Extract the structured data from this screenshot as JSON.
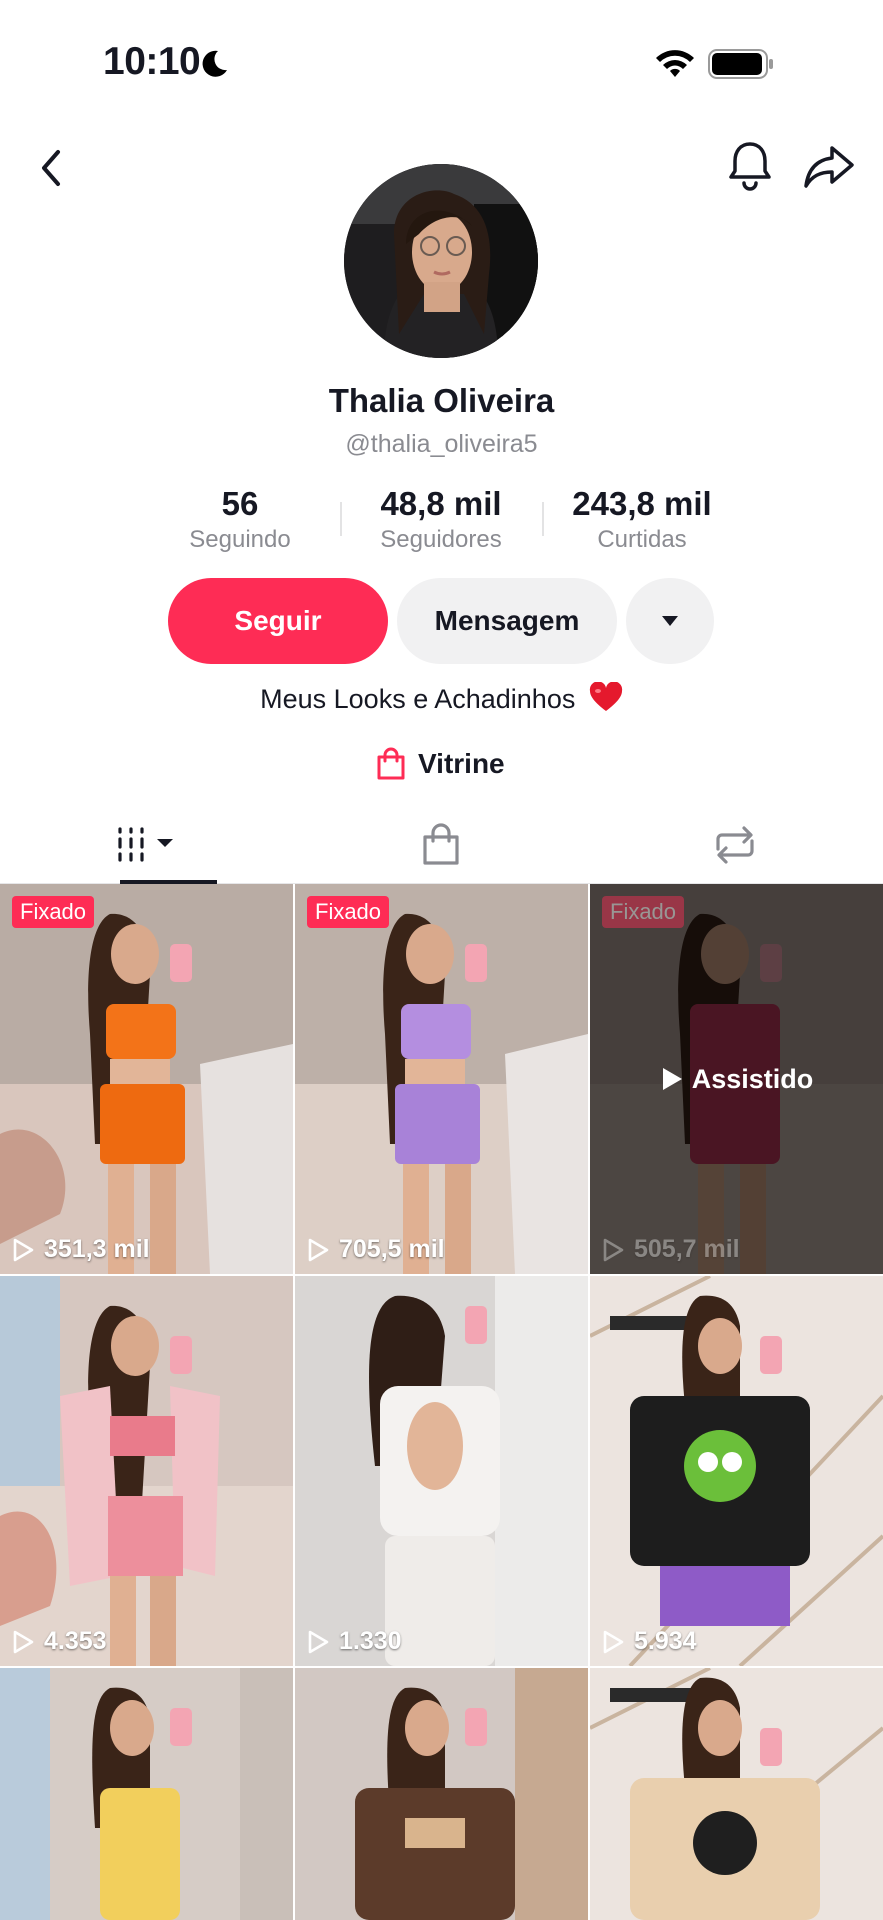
{
  "status_bar": {
    "time": "10:10",
    "icons": [
      "moon-icon",
      "wifi-icon",
      "battery-icon"
    ]
  },
  "nav": {
    "icons": [
      "back-icon",
      "bell-icon",
      "share-icon"
    ]
  },
  "profile": {
    "name": "Thalia Oliveira",
    "handle": "@thalia_oliveira5",
    "stats": [
      {
        "value": "56",
        "label": "Seguindo"
      },
      {
        "value": "48,8 mil",
        "label": "Seguidores"
      },
      {
        "value": "243,8 mil",
        "label": "Curtidas"
      }
    ],
    "bio": "Meus Looks e Achadinhos",
    "bio_emoji": "heart-emoji"
  },
  "actions": {
    "follow_label": "Seguir",
    "message_label": "Mensagem",
    "more_icon": "caret-down-icon"
  },
  "showcase": {
    "label": "Vitrine",
    "icon": "shopping-bag-icon"
  },
  "tabs": [
    {
      "name": "videos",
      "icon": "grid-icon",
      "active": true
    },
    {
      "name": "shop",
      "icon": "shopping-bag-icon",
      "active": false
    },
    {
      "name": "reposts",
      "icon": "repost-icon",
      "active": false
    }
  ],
  "videos": [
    {
      "views": "351,3 mil",
      "pinned": "Fixado"
    },
    {
      "views": "705,5 mil",
      "pinned": "Fixado"
    },
    {
      "views": "505,7 mil",
      "pinned": "Fixado",
      "watched": "Assistido"
    },
    {
      "views": "4.353"
    },
    {
      "views": "1.330"
    },
    {
      "views": "5.934"
    },
    {
      "views": ""
    },
    {
      "views": ""
    },
    {
      "views": ""
    }
  ],
  "colors": {
    "accent": "#fe2c55",
    "text": "#161823",
    "muted": "#8a8b91",
    "button_gray": "#f1f1f2"
  }
}
